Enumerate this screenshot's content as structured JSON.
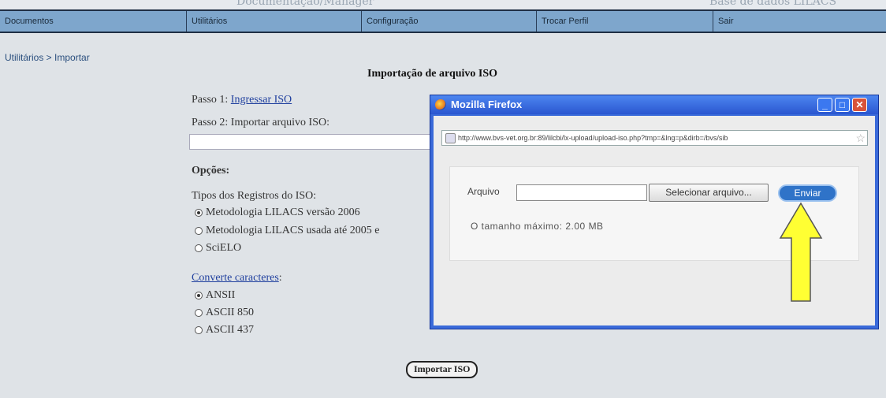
{
  "topstrip": {
    "left_text": "Documentação/Manager",
    "right_text": "Base de dados LILACS"
  },
  "menu": [
    "Documentos",
    "Utilitários",
    "Configuração",
    "Trocar Perfil",
    "Sair"
  ],
  "breadcrumb": "Utilitários > Importar",
  "page_title": "Importação de arquivo ISO",
  "step1": {
    "prefix": "Passo 1:",
    "link": "Ingressar ISO"
  },
  "step2": "Passo 2: Importar arquivo ISO:",
  "options_title": "Opções:",
  "record_types": {
    "label": "Tipos dos Registros do ISO:",
    "options": [
      "Metodologia LILACS versão 2006",
      "Metodologia LILACS usada até 2005 e",
      "SciELO"
    ],
    "selected": 0
  },
  "convert": {
    "link": "Converte caracteres",
    "suffix": ":",
    "options": [
      "ANSII",
      "ASCII 850",
      "ASCII 437"
    ],
    "selected": 0
  },
  "import_button": "Importar ISO",
  "popup": {
    "title": "Mozilla Firefox",
    "url": "http://www.bvs-vet.org.br:89/lilcbi/lx-upload/upload-iso.php?tmp=&lng=p&dirb=/bvs/sib",
    "file_label": "Arquivo",
    "select_button": "Selecionar arquivo...",
    "send_button": "Enviar",
    "max_size": "O tamanho máximo: 2.00 MB"
  },
  "colors": {
    "menu": "#7ea6cc",
    "popup_frame": "#3a6ad9",
    "arrow": "#ffff33"
  }
}
